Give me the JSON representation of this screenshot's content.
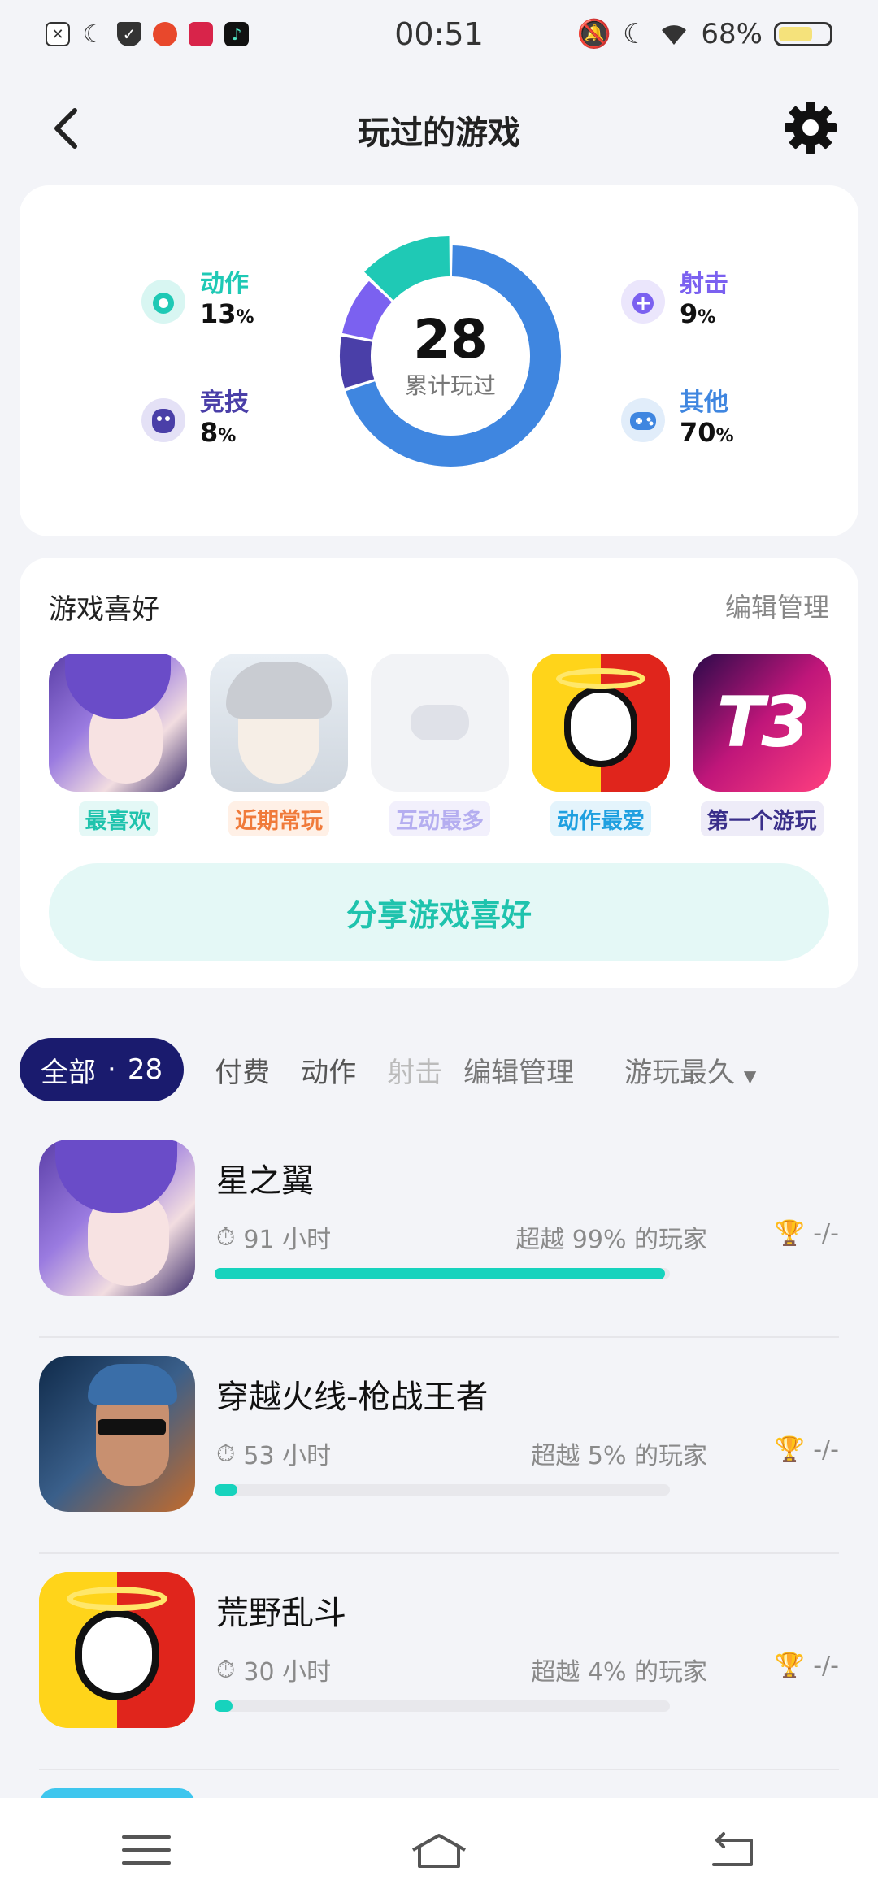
{
  "status": {
    "time": "00:51",
    "battery": "68%",
    "battery_level": 0.68
  },
  "header": {
    "title": "玩过的游戏"
  },
  "stats": {
    "total": "28",
    "total_label": "累计玩过",
    "items": [
      {
        "label": "动作",
        "value": "13",
        "unit": "%",
        "color": "#1fc9b5"
      },
      {
        "label": "竞技",
        "value": "8",
        "unit": "%",
        "color": "#4a3fa8"
      },
      {
        "label": "射击",
        "value": "9",
        "unit": "%",
        "color": "#7b61f0"
      },
      {
        "label": "其他",
        "value": "70",
        "unit": "%",
        "color": "#3f86e0"
      }
    ]
  },
  "prefs": {
    "title": "游戏喜好",
    "edit": "编辑管理",
    "items": [
      {
        "tag": "最喜欢",
        "tag_color": "#1fc3ad",
        "tag_bg": "#e4f8f6"
      },
      {
        "tag": "近期常玩",
        "tag_color": "#f07a3a",
        "tag_bg": "#fff0e6"
      },
      {
        "tag": "互动最多",
        "tag_color": "#b5aef0",
        "tag_bg": "#f2f0fc"
      },
      {
        "tag": "动作最爱",
        "tag_color": "#1fa0e0",
        "tag_bg": "#e4f4fc"
      },
      {
        "tag": "第一个游玩",
        "tag_color": "#3a2f8a",
        "tag_bg": "#eeecf8"
      }
    ],
    "share": "分享游戏喜好"
  },
  "tabs": {
    "all": "全部",
    "count": "28",
    "items": [
      "付费",
      "动作",
      "射击"
    ],
    "edit": "编辑管理",
    "sort": "游玩最久"
  },
  "games": [
    {
      "name": "星之翼",
      "hours": "91 小时",
      "beat": "超越 99% 的玩家",
      "trophy": "-/-",
      "progress": 0.99
    },
    {
      "name": "穿越火线-枪战王者",
      "hours": "53 小时",
      "beat": "超越 5% 的玩家",
      "trophy": "-/-",
      "progress": 0.05
    },
    {
      "name": "荒野乱斗",
      "hours": "30 小时",
      "beat": "超越 4% 的玩家",
      "trophy": "-/-",
      "progress": 0.04
    }
  ]
}
